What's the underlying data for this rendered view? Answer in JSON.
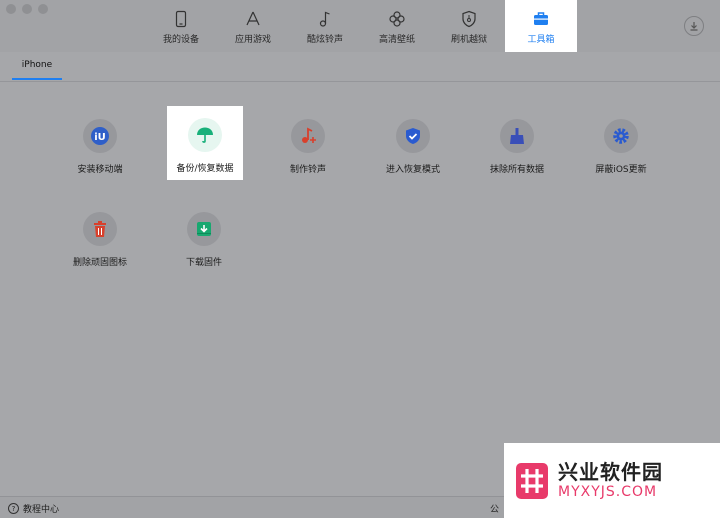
{
  "nav": {
    "items": [
      {
        "label": "我的设备",
        "icon": "phone-icon"
      },
      {
        "label": "应用游戏",
        "icon": "app-store-icon"
      },
      {
        "label": "酷炫铃声",
        "icon": "music-note-icon"
      },
      {
        "label": "高清壁纸",
        "icon": "clover-icon"
      },
      {
        "label": "刷机越狱",
        "icon": "shield-icon"
      },
      {
        "label": "工具箱",
        "icon": "toolbox-icon",
        "active": true
      }
    ],
    "download_icon": "download-icon",
    "accent": "#1f7ff0"
  },
  "tabs": [
    {
      "label": "iPhone",
      "active": true
    }
  ],
  "tools": {
    "row1": [
      {
        "label": "安装移动端",
        "icon": "iu-app-icon",
        "color": "#2f5fc8"
      },
      {
        "label": "备份/恢复数据",
        "icon": "umbrella-icon",
        "color": "#18b07a",
        "highlighted": true
      },
      {
        "label": "制作铃声",
        "icon": "music-plus-icon",
        "color": "#d8402c"
      },
      {
        "label": "进入恢复模式",
        "icon": "shield-check-icon",
        "color": "#2a5bd0"
      },
      {
        "label": "抹除所有数据",
        "icon": "broom-icon",
        "color": "#3a4fb8"
      },
      {
        "label": "屏蔽iOS更新",
        "icon": "gear-icon",
        "color": "#2a5bd0"
      }
    ],
    "row2": [
      {
        "label": "删除顽固图标",
        "icon": "trash-icon",
        "color": "#d8402c"
      },
      {
        "label": "下载固件",
        "icon": "download-box-icon",
        "color": "#18a870"
      }
    ]
  },
  "statusbar": {
    "help_label": "教程中心",
    "announce_label": "公"
  },
  "watermark": {
    "name_cn": "兴业软件园",
    "name_en": "MYXYJS.COM"
  }
}
